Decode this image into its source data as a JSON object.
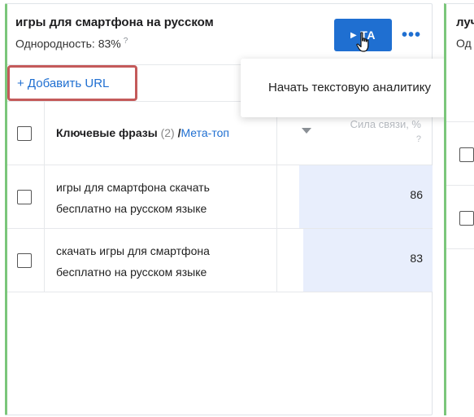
{
  "cluster": {
    "title": "игры для смартфона на русском",
    "homogeneity_label": "Однородность: 83%",
    "homogeneity_help": "?",
    "ta_button_label": "ТА",
    "more_icon": "ellipsis-horizontal-icon",
    "add_url_label": "+ Добавить URL"
  },
  "menu": {
    "items": [
      "Начать текстовую аналитику"
    ]
  },
  "table": {
    "header": {
      "phrase_label": "Ключевые фразы",
      "phrase_count": "(2)",
      "separator": " /",
      "meta_label": "Мета-топ",
      "score_label": "Сила связи, %",
      "score_help": "?"
    },
    "rows": [
      {
        "phrase": "игры для смартфона скачать бесплатно на русском языке",
        "score": "86",
        "score_fraction": 0.86
      },
      {
        "phrase": "скачать игры для смартфона бесплатно на русском языке",
        "score": "83",
        "score_fraction": 0.83
      }
    ]
  },
  "next_cluster": {
    "title_fragment": "луч",
    "sub_fragment": "Од"
  },
  "colors": {
    "accent": "#1f6fd1",
    "card_border_left": "#7bc67b",
    "highlight_border": "#c45a5a",
    "score_fill": "#e8eefc"
  }
}
